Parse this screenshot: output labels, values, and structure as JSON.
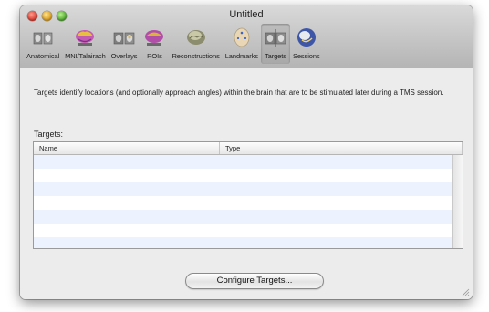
{
  "window": {
    "title": "Untitled"
  },
  "toolbar": {
    "items": [
      {
        "label": "Anatomical",
        "icon": "brain-slice-icon"
      },
      {
        "label": "MNI/Talairach",
        "icon": "colored-brain-icon"
      },
      {
        "label": "Overlays",
        "icon": "overlay-slices-icon"
      },
      {
        "label": "ROIs",
        "icon": "roi-brain-icon"
      },
      {
        "label": "Reconstructions",
        "icon": "brain-reconstruction-icon"
      },
      {
        "label": "Landmarks",
        "icon": "head-landmarks-icon"
      },
      {
        "label": "Targets",
        "icon": "target-slices-icon",
        "selected": true
      },
      {
        "label": "Sessions",
        "icon": "sessions-globe-icon"
      }
    ]
  },
  "main": {
    "description": "Targets identify locations (and optionally approach angles) within the brain that are to be stimulated later during a TMS session.",
    "targets_label": "Targets:",
    "table": {
      "columns": [
        "Name",
        "Type"
      ],
      "rows": []
    },
    "configure_button": "Configure Targets..."
  },
  "colors": {
    "row_alt": "#edf3fe",
    "selected_tool": "#b3b3b3"
  }
}
